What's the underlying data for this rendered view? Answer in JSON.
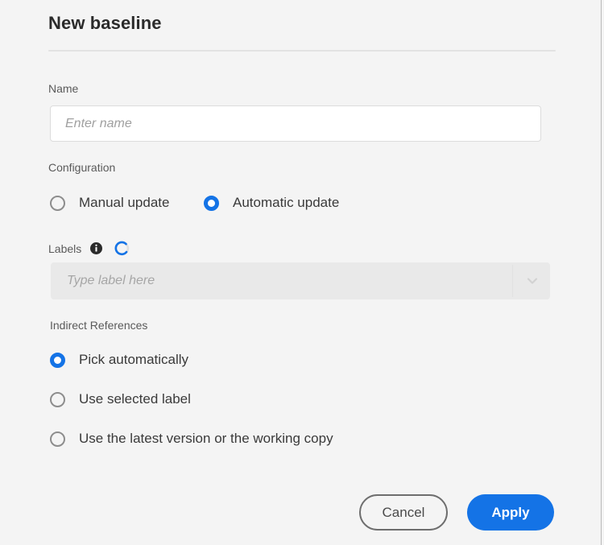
{
  "dialog": {
    "title": "New baseline"
  },
  "name_field": {
    "label": "Name",
    "value": "",
    "placeholder": "Enter name"
  },
  "configuration": {
    "label": "Configuration",
    "options": [
      {
        "label": "Manual update",
        "selected": false
      },
      {
        "label": "Automatic update",
        "selected": true
      }
    ]
  },
  "labels": {
    "label": "Labels",
    "info_icon": "info-icon",
    "spinner_icon": "loading-spinner-icon",
    "loading": true,
    "value": "",
    "placeholder": "Type label here",
    "chevron_icon": "chevron-down-icon",
    "disabled": true
  },
  "indirect_references": {
    "label": "Indirect References",
    "options": [
      {
        "label": "Pick automatically",
        "selected": true
      },
      {
        "label": "Use selected label",
        "selected": false
      },
      {
        "label": "Use the latest version or the working copy",
        "selected": false
      }
    ]
  },
  "footer": {
    "cancel_label": "Cancel",
    "apply_label": "Apply"
  },
  "colors": {
    "accent_blue": "#1473e6",
    "background": "#f4f4f4",
    "text": "#2c2c2c",
    "label_text": "#5a5a5a",
    "disabled_field": "#e9e9e9",
    "border": "#dcdcdc"
  }
}
